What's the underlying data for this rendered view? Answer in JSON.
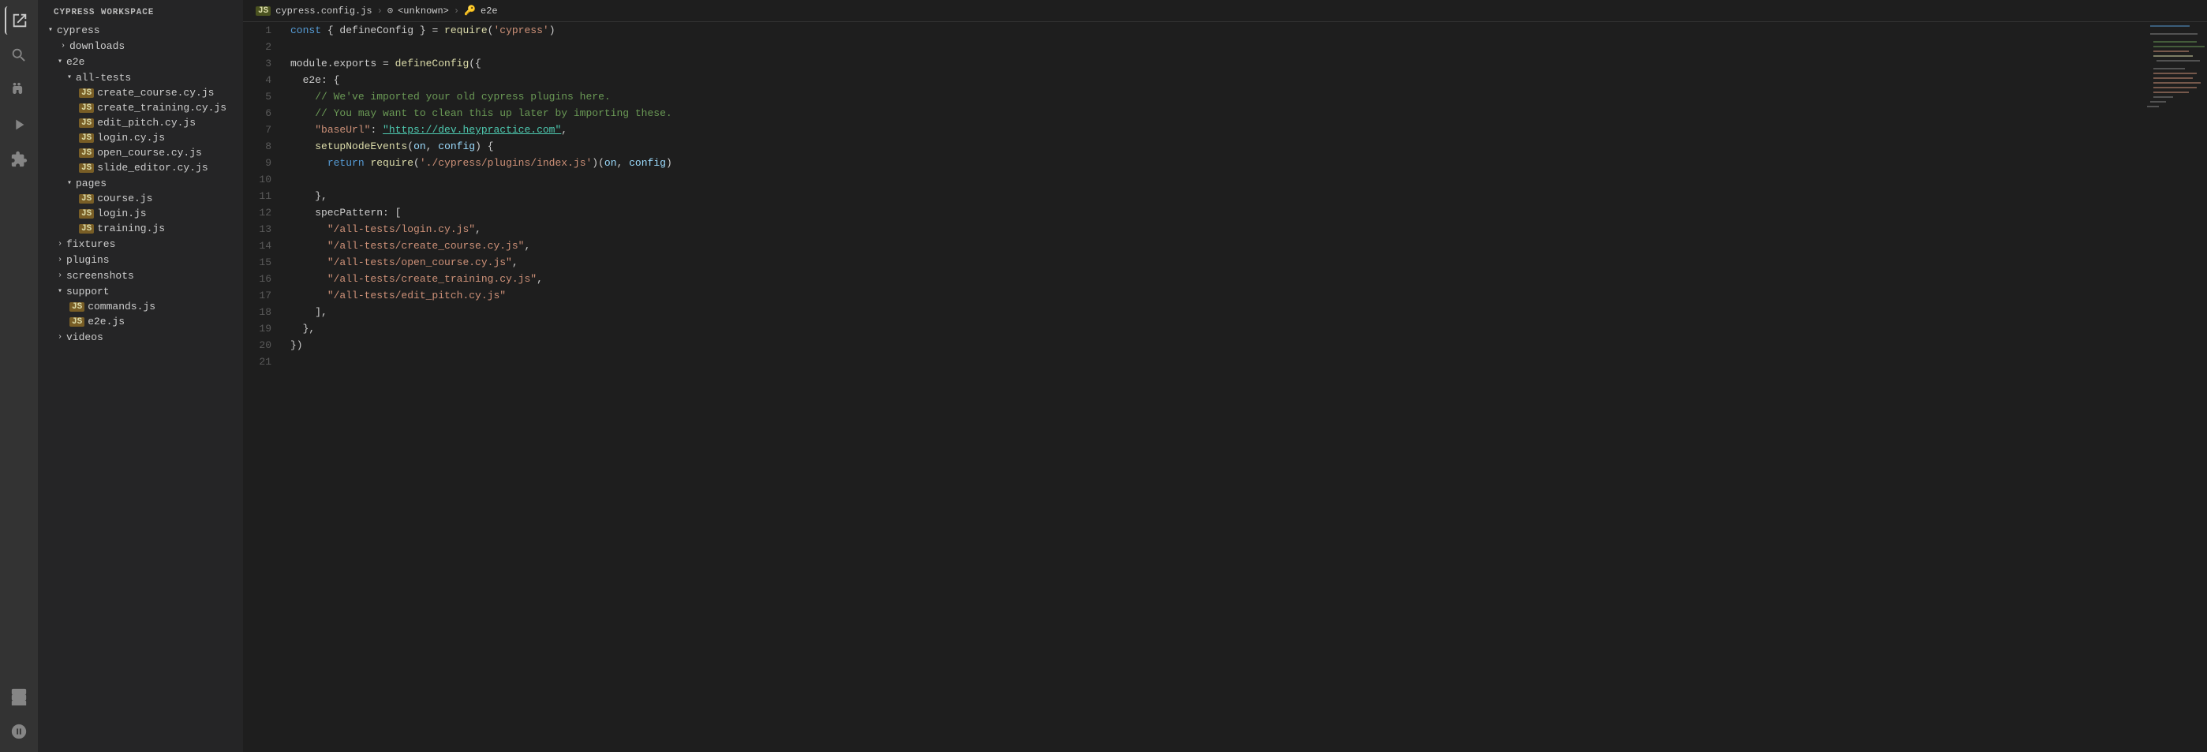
{
  "activityBar": {
    "icons": [
      {
        "name": "explorer-icon",
        "symbol": "☰",
        "active": true
      },
      {
        "name": "search-icon",
        "symbol": "🔍",
        "active": false
      },
      {
        "name": "source-control-icon",
        "symbol": "⑂",
        "active": false
      },
      {
        "name": "run-debug-icon",
        "symbol": "▷",
        "active": false
      },
      {
        "name": "extensions-icon",
        "symbol": "⊞",
        "active": false
      },
      {
        "name": "remote-explorer-icon",
        "symbol": "⬡",
        "active": false
      },
      {
        "name": "docker-icon",
        "symbol": "🐳",
        "active": false
      }
    ]
  },
  "sidebar": {
    "title": "CYPRESS WORKSPACE",
    "tree": [
      {
        "id": "cypress",
        "label": "cypress",
        "indent": 0,
        "type": "folder",
        "open": true
      },
      {
        "id": "downloads",
        "label": "downloads",
        "indent": 1,
        "type": "folder",
        "open": false
      },
      {
        "id": "e2e",
        "label": "e2e",
        "indent": 1,
        "type": "folder",
        "open": true
      },
      {
        "id": "all-tests",
        "label": "all-tests",
        "indent": 2,
        "type": "folder",
        "open": true
      },
      {
        "id": "create_course",
        "label": "create_course.cy.js",
        "indent": 3,
        "type": "js"
      },
      {
        "id": "create_training",
        "label": "create_training.cy.js",
        "indent": 3,
        "type": "js"
      },
      {
        "id": "edit_pitch",
        "label": "edit_pitch.cy.js",
        "indent": 3,
        "type": "js"
      },
      {
        "id": "login",
        "label": "login.cy.js",
        "indent": 3,
        "type": "js"
      },
      {
        "id": "open_course",
        "label": "open_course.cy.js",
        "indent": 3,
        "type": "js"
      },
      {
        "id": "slide_editor",
        "label": "slide_editor.cy.js",
        "indent": 3,
        "type": "js"
      },
      {
        "id": "pages",
        "label": "pages",
        "indent": 2,
        "type": "folder",
        "open": true
      },
      {
        "id": "course",
        "label": "course.js",
        "indent": 3,
        "type": "js"
      },
      {
        "id": "login_js",
        "label": "login.js",
        "indent": 3,
        "type": "js"
      },
      {
        "id": "training",
        "label": "training.js",
        "indent": 3,
        "type": "js"
      },
      {
        "id": "fixtures",
        "label": "fixtures",
        "indent": 1,
        "type": "folder",
        "open": false
      },
      {
        "id": "plugins",
        "label": "plugins",
        "indent": 1,
        "type": "folder",
        "open": false
      },
      {
        "id": "screenshots",
        "label": "screenshots",
        "indent": 1,
        "type": "folder",
        "open": false
      },
      {
        "id": "support",
        "label": "support",
        "indent": 1,
        "type": "folder",
        "open": true
      },
      {
        "id": "commands",
        "label": "commands.js",
        "indent": 2,
        "type": "js"
      },
      {
        "id": "e2e_js",
        "label": "e2e.js",
        "indent": 2,
        "type": "js"
      },
      {
        "id": "videos",
        "label": "videos",
        "indent": 1,
        "type": "folder",
        "open": false
      }
    ]
  },
  "breadcrumb": {
    "items": [
      {
        "icon": "js",
        "label": "cypress.config.js"
      },
      {
        "icon": "scope",
        "label": "<unknown>"
      },
      {
        "icon": "key",
        "label": "e2e"
      }
    ]
  },
  "editor": {
    "lines": [
      {
        "num": 1,
        "tokens": [
          {
            "t": "keyword",
            "v": "const"
          },
          {
            "t": "white",
            "v": " { defineConfig } = "
          },
          {
            "t": "func",
            "v": "require"
          },
          {
            "t": "white",
            "v": "("
          },
          {
            "t": "string",
            "v": "'cypress'"
          },
          {
            "t": "white",
            "v": ")"
          }
        ]
      },
      {
        "num": 2,
        "tokens": []
      },
      {
        "num": 3,
        "tokens": [
          {
            "t": "white",
            "v": "module.exports = "
          },
          {
            "t": "func",
            "v": "defineConfig"
          },
          {
            "t": "white",
            "v": "({"
          }
        ]
      },
      {
        "num": 4,
        "tokens": [
          {
            "t": "white",
            "v": "  e2e: {"
          }
        ]
      },
      {
        "num": 5,
        "tokens": [
          {
            "t": "comment",
            "v": "    // We've imported your old cypress plugins here."
          }
        ]
      },
      {
        "num": 6,
        "tokens": [
          {
            "t": "comment",
            "v": "    // You may want to clean this up later by importing these."
          }
        ]
      },
      {
        "num": 7,
        "tokens": [
          {
            "t": "white",
            "v": "    "
          },
          {
            "t": "string",
            "v": "\"baseUrl\""
          },
          {
            "t": "white",
            "v": ": "
          },
          {
            "t": "url",
            "v": "\"https://dev.heypractice.com\""
          },
          {
            "t": "white",
            "v": ","
          }
        ]
      },
      {
        "num": 8,
        "tokens": [
          {
            "t": "white",
            "v": "    "
          },
          {
            "t": "func",
            "v": "setupNodeEvents"
          },
          {
            "t": "white",
            "v": "("
          },
          {
            "t": "param",
            "v": "on"
          },
          {
            "t": "white",
            "v": ", "
          },
          {
            "t": "param",
            "v": "config"
          },
          {
            "t": "white",
            "v": ") {"
          }
        ]
      },
      {
        "num": 9,
        "tokens": [
          {
            "t": "white",
            "v": "      "
          },
          {
            "t": "keyword",
            "v": "return"
          },
          {
            "t": "white",
            "v": " "
          },
          {
            "t": "func",
            "v": "require"
          },
          {
            "t": "white",
            "v": "("
          },
          {
            "t": "string",
            "v": "'./cypress/plugins/index.js'"
          },
          {
            "t": "white",
            "v": ")("
          },
          {
            "t": "param",
            "v": "on"
          },
          {
            "t": "white",
            "v": ", "
          },
          {
            "t": "param",
            "v": "config"
          },
          {
            "t": "white",
            "v": ")"
          }
        ]
      },
      {
        "num": 10,
        "tokens": []
      },
      {
        "num": 11,
        "tokens": [
          {
            "t": "white",
            "v": "    },"
          }
        ]
      },
      {
        "num": 12,
        "tokens": [
          {
            "t": "white",
            "v": "    specPattern: ["
          }
        ]
      },
      {
        "num": 13,
        "tokens": [
          {
            "t": "white",
            "v": "      "
          },
          {
            "t": "string",
            "v": "\"/all-tests/login.cy.js\""
          }
        ],
        "comma": true
      },
      {
        "num": 14,
        "tokens": [
          {
            "t": "white",
            "v": "      "
          },
          {
            "t": "string",
            "v": "\"/all-tests/create_course.cy.js\""
          }
        ],
        "comma": true
      },
      {
        "num": 15,
        "tokens": [
          {
            "t": "white",
            "v": "      "
          },
          {
            "t": "string",
            "v": "\"/all-tests/open_course.cy.js\""
          }
        ],
        "comma": true
      },
      {
        "num": 16,
        "tokens": [
          {
            "t": "white",
            "v": "      "
          },
          {
            "t": "string",
            "v": "\"/all-tests/create_training.cy.js\""
          }
        ],
        "comma": true
      },
      {
        "num": 17,
        "tokens": [
          {
            "t": "white",
            "v": "      "
          },
          {
            "t": "string",
            "v": "\"/all-tests/edit_pitch.cy.js\""
          }
        ]
      },
      {
        "num": 18,
        "tokens": [
          {
            "t": "white",
            "v": "    ],"
          }
        ]
      },
      {
        "num": 19,
        "tokens": [
          {
            "t": "white",
            "v": "  },"
          }
        ]
      },
      {
        "num": 20,
        "tokens": [
          {
            "t": "white",
            "v": "})"
          }
        ]
      },
      {
        "num": 21,
        "tokens": []
      }
    ]
  }
}
